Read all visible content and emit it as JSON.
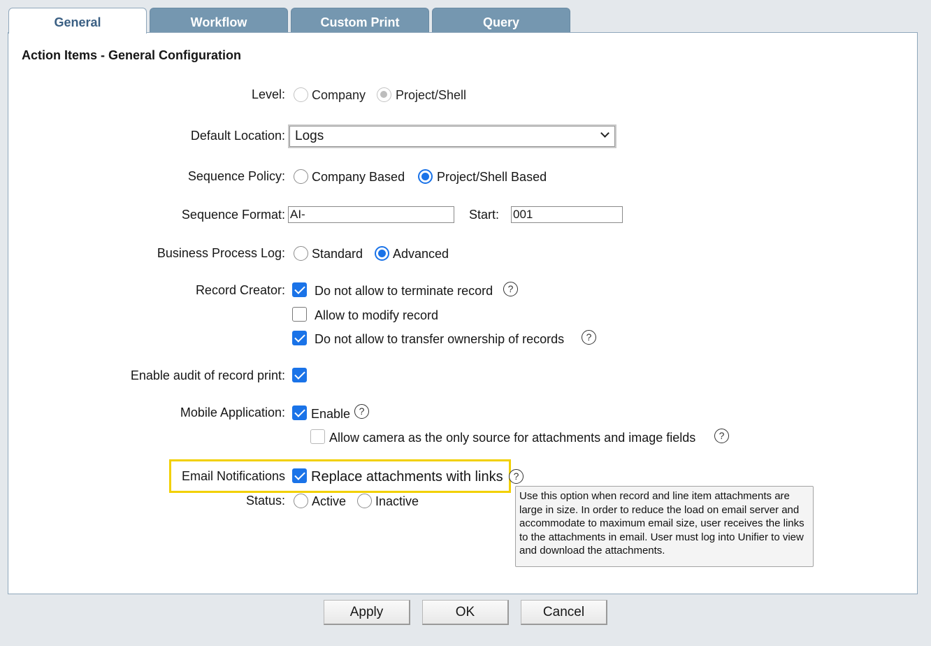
{
  "tabs": [
    {
      "label": "General",
      "active": true
    },
    {
      "label": "Workflow",
      "active": false
    },
    {
      "label": "Custom Print",
      "active": false
    },
    {
      "label": "Query",
      "active": false
    }
  ],
  "title": "Action Items - General Configuration",
  "level": {
    "label": "Level:",
    "options": [
      "Company",
      "Project/Shell"
    ],
    "selected": "Project/Shell",
    "disabled": true
  },
  "default_location": {
    "label": "Default Location:",
    "value": "Logs"
  },
  "sequence_policy": {
    "label": "Sequence Policy:",
    "options": [
      "Company Based",
      "Project/Shell Based"
    ],
    "selected": "Project/Shell Based"
  },
  "sequence_format": {
    "label": "Sequence Format:",
    "value": "AI-",
    "start_label": "Start:",
    "start_value": "001"
  },
  "business_process_log": {
    "label": "Business Process Log:",
    "options": [
      "Standard",
      "Advanced"
    ],
    "selected": "Advanced"
  },
  "record_creator": {
    "label": "Record Creator:",
    "options": [
      {
        "label": "Do not allow to terminate record",
        "checked": true,
        "help": true
      },
      {
        "label": "Allow to modify record",
        "checked": false,
        "help": false
      },
      {
        "label": "Do not allow to transfer ownership of records",
        "checked": true,
        "help": true
      }
    ]
  },
  "audit": {
    "label": "Enable audit of record print:",
    "checked": true
  },
  "mobile": {
    "label": "Mobile Application:",
    "enable_label": "Enable",
    "enable_checked": true,
    "camera_label": "Allow camera as the only source for attachments and image fields",
    "camera_checked": false
  },
  "email": {
    "label": "Email Notifications",
    "option_label": "Replace attachments with links",
    "checked": true,
    "highlight_color": "#f2d000"
  },
  "status": {
    "label": "Status:",
    "options": [
      "Active",
      "Inactive"
    ],
    "selected": null
  },
  "tooltip": {
    "text": "Use this option when record and line item attachments are large in size. In order to reduce the load on email server and accommodate to maximum email size, user receives the links to the attachments in email. User must log into Unifier to view and download the attachments."
  },
  "buttons": {
    "apply": "Apply",
    "ok": "OK",
    "cancel": "Cancel"
  },
  "help_glyph": "?",
  "colors": {
    "tab_bg": "#7597b0",
    "accent": "#1a73e8",
    "active_tab_text": "#3a5f83"
  }
}
